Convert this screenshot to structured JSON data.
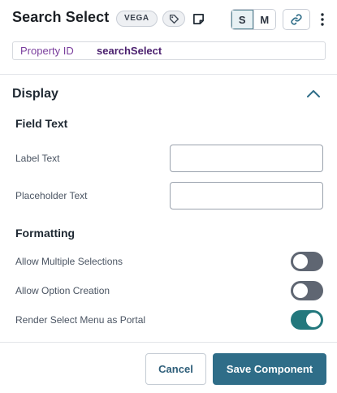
{
  "header": {
    "title": "Search Select",
    "badge": "VEGA",
    "size_options": [
      "S",
      "M"
    ],
    "active_size": "S",
    "icons": [
      "tag-icon",
      "note-icon",
      "link-icon",
      "kebab-menu-icon"
    ]
  },
  "property": {
    "key": "Property ID",
    "value": "searchSelect"
  },
  "section": {
    "title": "Display",
    "expanded": true
  },
  "field_text": {
    "heading": "Field Text",
    "label_text": {
      "label": "Label Text",
      "value": ""
    },
    "placeholder_text": {
      "label": "Placeholder Text",
      "value": ""
    }
  },
  "formatting": {
    "heading": "Formatting",
    "toggles": [
      {
        "label": "Allow Multiple Selections",
        "on": false
      },
      {
        "label": "Allow Option Creation",
        "on": false
      },
      {
        "label": "Render Select Menu as Portal",
        "on": true
      }
    ]
  },
  "footer": {
    "cancel_label": "Cancel",
    "save_label": "Save Component"
  },
  "colors": {
    "accent": "#23787d",
    "primary_button": "#2f6d88",
    "property_key": "#7a3e9d"
  }
}
